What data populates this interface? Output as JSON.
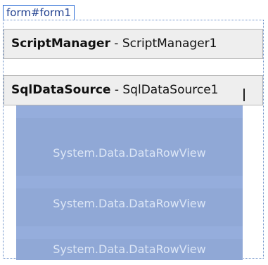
{
  "form": {
    "tag": "form#form1"
  },
  "components": [
    {
      "type": "ScriptManager",
      "separator": " - ",
      "id": "ScriptManager1"
    },
    {
      "type": "SqlDataSource",
      "separator": " - ",
      "id": "SqlDataSource1"
    }
  ],
  "datalist": {
    "items": [
      "System.Data.DataRowView",
      "System.Data.DataRowView",
      "System.Data.DataRowView"
    ]
  },
  "colors": {
    "form_tag_border": "#2f6fd6",
    "component_background": "#eeeeee",
    "datalist_background": "#90a8d6",
    "datalist_text": "#dce6f6"
  }
}
